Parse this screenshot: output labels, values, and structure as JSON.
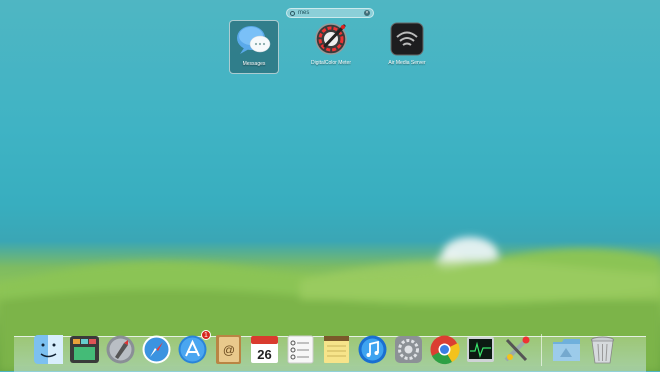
{
  "search": {
    "query": "mes",
    "placeholder": ""
  },
  "apps": [
    {
      "label": "Messages",
      "icon": "messages-icon",
      "selected": true
    },
    {
      "label": "DigitalColor Meter",
      "icon": "digital-color-meter-icon",
      "selected": false
    },
    {
      "label": "Air Media Server",
      "icon": "air-media-server-icon",
      "selected": false
    }
  ],
  "dock": {
    "items": [
      {
        "name": "finder",
        "icon": "finder-icon"
      },
      {
        "name": "mission-control",
        "icon": "mission-control-icon"
      },
      {
        "name": "launchpad",
        "icon": "launchpad-icon"
      },
      {
        "name": "safari",
        "icon": "safari-icon"
      },
      {
        "name": "app-store",
        "icon": "app-store-icon",
        "badge": "1"
      },
      {
        "name": "contacts",
        "icon": "contacts-icon"
      },
      {
        "name": "calendar",
        "icon": "calendar-icon",
        "day": "26"
      },
      {
        "name": "reminders",
        "icon": "reminders-icon"
      },
      {
        "name": "notes",
        "icon": "notes-icon"
      },
      {
        "name": "itunes",
        "icon": "itunes-icon"
      },
      {
        "name": "system-preferences",
        "icon": "system-preferences-icon"
      },
      {
        "name": "chrome",
        "icon": "chrome-icon"
      },
      {
        "name": "activity-monitor",
        "icon": "activity-monitor-icon"
      },
      {
        "name": "utilities",
        "icon": "utilities-icon"
      },
      {
        "name": "applications-folder",
        "icon": "folder-icon"
      },
      {
        "name": "trash",
        "icon": "trash-icon"
      }
    ]
  },
  "colors": {
    "sky": "#3fb3c4",
    "hills": "#86c052",
    "selection": "#1f4a55"
  }
}
